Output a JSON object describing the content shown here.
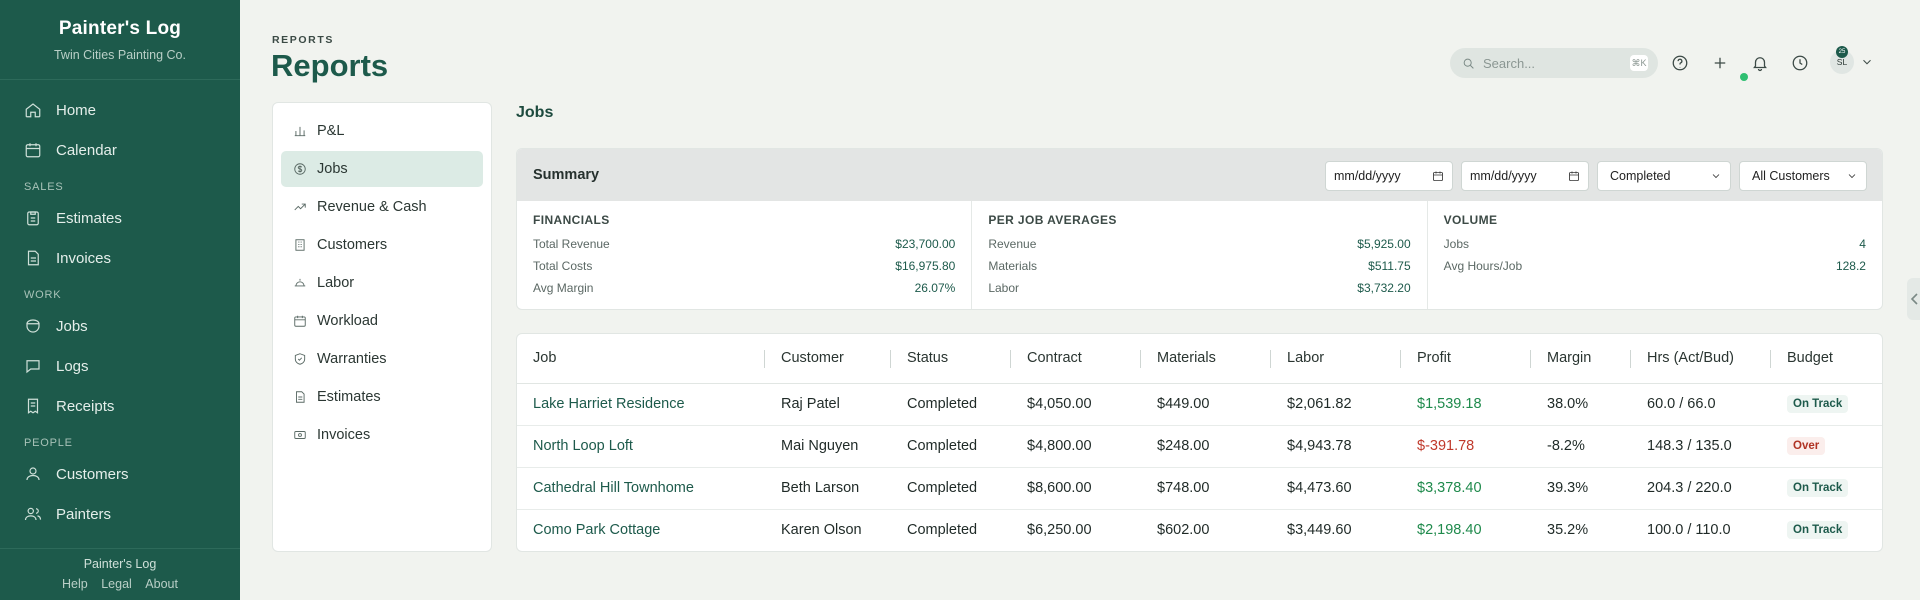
{
  "sidebar": {
    "brand_name": "Painter's Log",
    "brand_sub": "Twin Cities Painting Co.",
    "home": "Home",
    "calendar": "Calendar",
    "section_sales": "SALES",
    "estimates": "Estimates",
    "invoices": "Invoices",
    "section_work": "WORK",
    "jobs": "Jobs",
    "logs": "Logs",
    "receipts": "Receipts",
    "section_people": "PEOPLE",
    "customers": "Customers",
    "painters": "Painters",
    "footer_title": "Painter's Log",
    "footer_help": "Help",
    "footer_legal": "Legal",
    "footer_about": "About"
  },
  "header": {
    "breadcrumb": "REPORTS",
    "title": "Reports",
    "search_placeholder": "Search...",
    "search_shortcut": "⌘K",
    "avatar_initials": "SL",
    "avatar_badge": "25"
  },
  "reports_menu": {
    "pl": "P&L",
    "jobs": "Jobs",
    "revenue_cash": "Revenue & Cash",
    "customers": "Customers",
    "labor": "Labor",
    "workload": "Workload",
    "warranties": "Warranties",
    "estimates": "Estimates",
    "invoices": "Invoices",
    "active": "jobs"
  },
  "main": {
    "section_title": "Jobs",
    "summary": {
      "title": "Summary",
      "date_from": "mm/dd/yyyy",
      "date_to": "mm/dd/yyyy",
      "status_filter": "Completed",
      "customer_filter": "All Customers",
      "financials": {
        "label": "FINANCIALS",
        "total_revenue_label": "Total Revenue",
        "total_revenue": "$23,700.00",
        "total_costs_label": "Total Costs",
        "total_costs": "$16,975.80",
        "avg_margin_label": "Avg Margin",
        "avg_margin": "26.07%"
      },
      "averages": {
        "label": "PER JOB AVERAGES",
        "revenue_label": "Revenue",
        "revenue": "$5,925.00",
        "materials_label": "Materials",
        "materials": "$511.75",
        "labor_label": "Labor",
        "labor": "$3,732.20"
      },
      "volume": {
        "label": "VOLUME",
        "jobs_label": "Jobs",
        "jobs": "4",
        "hours_label": "Avg Hours/Job",
        "hours": "128.2"
      }
    },
    "table": {
      "headers": {
        "job": "Job",
        "customer": "Customer",
        "status": "Status",
        "contract": "Contract",
        "materials": "Materials",
        "labor": "Labor",
        "profit": "Profit",
        "margin": "Margin",
        "hours": "Hrs (Act/Bud)",
        "budget": "Budget"
      },
      "rows": [
        {
          "job": "Lake Harriet Residence",
          "customer": "Raj Patel",
          "status": "Completed",
          "contract": "$4,050.00",
          "materials": "$449.00",
          "labor": "$2,061.82",
          "profit": "$1,539.18",
          "margin": "38.0%",
          "hours": "60.0 / 66.0",
          "budget": "On Track"
        },
        {
          "job": "North Loop Loft",
          "customer": "Mai Nguyen",
          "status": "Completed",
          "contract": "$4,800.00",
          "materials": "$248.00",
          "labor": "$4,943.78",
          "profit": "$-391.78",
          "margin": "-8.2%",
          "hours": "148.3 / 135.0",
          "budget": "Over"
        },
        {
          "job": "Cathedral Hill Townhome",
          "customer": "Beth Larson",
          "status": "Completed",
          "contract": "$8,600.00",
          "materials": "$748.00",
          "labor": "$4,473.60",
          "profit": "$3,378.40",
          "margin": "39.3%",
          "hours": "204.3 / 220.0",
          "budget": "On Track"
        },
        {
          "job": "Como Park Cottage",
          "customer": "Karen Olson",
          "status": "Completed",
          "contract": "$6,250.00",
          "materials": "$602.00",
          "labor": "$3,449.60",
          "profit": "$2,198.40",
          "margin": "35.2%",
          "hours": "100.0 / 110.0",
          "budget": "On Track"
        }
      ]
    }
  },
  "colors": {
    "sidebar_bg": "#1d5a4b",
    "accent": "#1d5a4b",
    "profit_positive": "#1f8a4c",
    "profit_negative": "#c0392b",
    "online": "#2fbf71"
  }
}
